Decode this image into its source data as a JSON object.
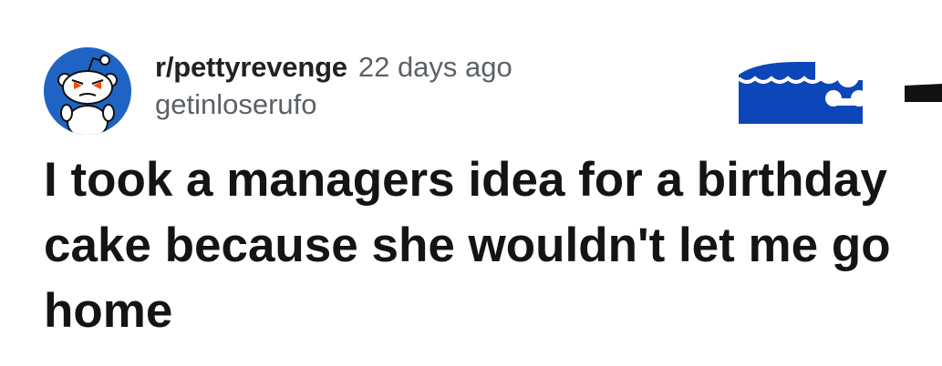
{
  "post": {
    "subreddit": "r/pettyrevenge",
    "time_ago": "22 days ago",
    "username": "getinloserufo",
    "title": "I took a managers idea for a birthday cake because she wouldn't let me go home"
  },
  "icons": {
    "avatar": "reddit-snoo-icon",
    "flair": "flair-badge-icon"
  },
  "colors": {
    "avatar_bg": "#1f64c4",
    "flair_bg": "#0c46b8",
    "title": "#141414",
    "meta": "#5c6166"
  }
}
